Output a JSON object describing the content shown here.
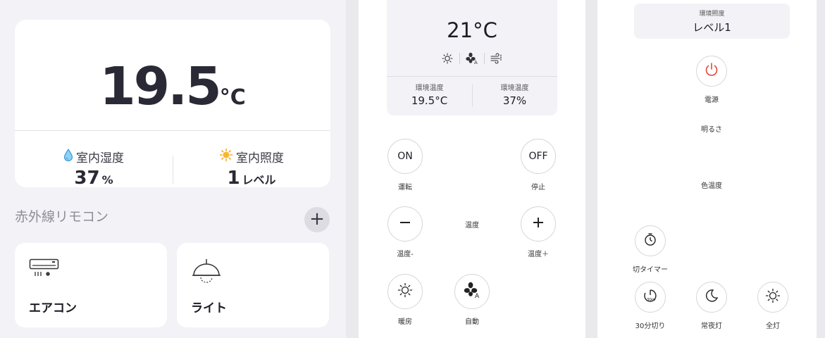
{
  "home": {
    "temperature": "19.5",
    "temperature_unit": "°C",
    "humidity_label": "室内湿度",
    "humidity_value": "37",
    "humidity_unit": "%",
    "illuminance_label": "室内照度",
    "illuminance_value": "1",
    "illuminance_unit": "レベル",
    "section_title": "赤外線リモコン",
    "add_symbol": "+",
    "devices": [
      {
        "name": "エアコン",
        "icon": "air-conditioner-icon"
      },
      {
        "name": "ライト",
        "icon": "ceiling-light-icon"
      }
    ]
  },
  "aircon": {
    "set_temperature": "21°C",
    "mode_icons": [
      "sun-icon",
      "fan-auto-icon",
      "wind-icon"
    ],
    "env_left_label": "環境温度",
    "env_left_value": "19.5°C",
    "env_right_label": "環境温度",
    "env_right_value": "37%",
    "buttons": {
      "on_text": "ON",
      "on_label": "運転",
      "off_text": "OFF",
      "off_label": "停止",
      "temp_label": "温度",
      "temp_down_label": "温度-",
      "temp_up_label": "温度＋",
      "heat_label": "暖房",
      "auto_label": "自動"
    }
  },
  "light": {
    "lux_label": "環境照度",
    "lux_value": "レベル1",
    "power_label": "電源",
    "brightness_label": "明るさ",
    "color_temp_label": "色温度",
    "off_timer_label": "切タイマー",
    "timer30_label": "30分切り",
    "night_label": "常夜灯",
    "full_label": "全灯",
    "power_color": "#e0483e"
  }
}
